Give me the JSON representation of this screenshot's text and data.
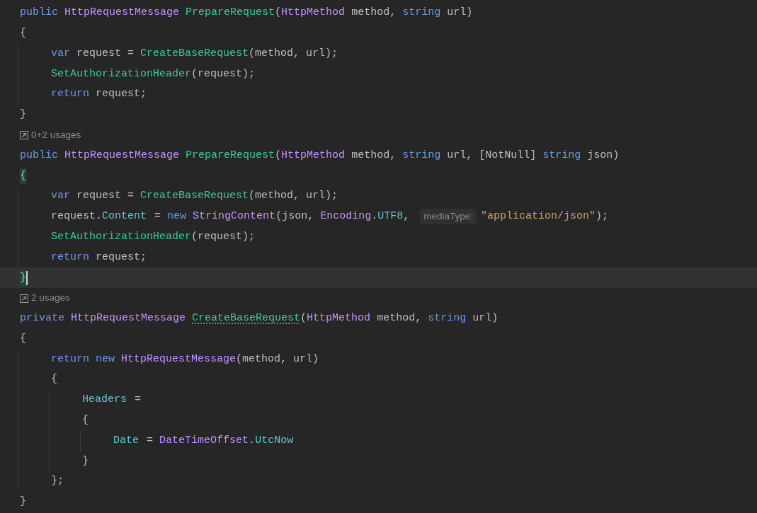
{
  "editor": {
    "lines": [
      {
        "kind": "code",
        "current": false,
        "tokens": [
          {
            "t": "public ",
            "kind": "keyword"
          },
          {
            "t": "HttpRequestMessage ",
            "kind": "type"
          },
          {
            "t": "PrepareRequest",
            "kind": "method"
          },
          {
            "t": "(",
            "kind": "plain"
          },
          {
            "t": "HttpMethod ",
            "kind": "type"
          },
          {
            "t": "method, ",
            "kind": "plain"
          },
          {
            "t": "string ",
            "kind": "keyword"
          },
          {
            "t": "url)",
            "kind": "plain"
          }
        ]
      },
      {
        "kind": "code",
        "current": false,
        "tokens": [
          {
            "t": "{",
            "kind": "plain"
          }
        ]
      },
      {
        "kind": "code",
        "current": false,
        "tokens": [
          {
            "t": "    var ",
            "kind": "keyword"
          },
          {
            "t": "request = ",
            "kind": "plain"
          },
          {
            "t": "CreateBaseRequest",
            "kind": "method"
          },
          {
            "t": "(method, url);",
            "kind": "plain"
          }
        ]
      },
      {
        "kind": "code",
        "current": false,
        "tokens": [
          {
            "t": "    SetAuthorizationHeader",
            "kind": "method"
          },
          {
            "t": "(request);",
            "kind": "plain"
          }
        ]
      },
      {
        "kind": "code",
        "current": false,
        "tokens": [
          {
            "t": "    return ",
            "kind": "keyword"
          },
          {
            "t": "request;",
            "kind": "plain"
          }
        ]
      },
      {
        "kind": "code",
        "current": false,
        "tokens": [
          {
            "t": "}",
            "kind": "plain"
          }
        ]
      },
      {
        "kind": "usages",
        "text": "0+2 usages"
      },
      {
        "kind": "code",
        "current": false,
        "tokens": [
          {
            "t": "public ",
            "kind": "keyword"
          },
          {
            "t": "HttpRequestMessage ",
            "kind": "type"
          },
          {
            "t": "PrepareRequest",
            "kind": "method"
          },
          {
            "t": "(",
            "kind": "plain"
          },
          {
            "t": "HttpMethod ",
            "kind": "type"
          },
          {
            "t": "method, ",
            "kind": "plain"
          },
          {
            "t": "string ",
            "kind": "keyword"
          },
          {
            "t": "url, [NotNull] ",
            "kind": "plain"
          },
          {
            "t": "string ",
            "kind": "keyword"
          },
          {
            "t": "json)",
            "kind": "plain"
          }
        ]
      },
      {
        "kind": "code",
        "current": false,
        "tokens": [
          {
            "t": "{",
            "kind": "plain",
            "matched": true
          }
        ]
      },
      {
        "kind": "code",
        "current": false,
        "tokens": [
          {
            "t": "    var ",
            "kind": "keyword"
          },
          {
            "t": "request = ",
            "kind": "plain"
          },
          {
            "t": "CreateBaseRequest",
            "kind": "method"
          },
          {
            "t": "(method, url);",
            "kind": "plain"
          }
        ]
      },
      {
        "kind": "code",
        "current": false,
        "tokens": [
          {
            "t": "    request.",
            "kind": "plain"
          },
          {
            "t": "Content",
            "kind": "field"
          },
          {
            "t": " = ",
            "kind": "plain"
          },
          {
            "t": "new ",
            "kind": "keyword"
          },
          {
            "t": "StringContent",
            "kind": "type"
          },
          {
            "t": "(json, ",
            "kind": "plain"
          },
          {
            "t": "Encoding",
            "kind": "type"
          },
          {
            "t": ".",
            "kind": "plain"
          },
          {
            "t": "UTF8",
            "kind": "field"
          },
          {
            "t": ", ",
            "kind": "plain"
          },
          {
            "t": "mediaType:",
            "kind": "hint"
          },
          {
            "t": "\"application/json\"",
            "kind": "string"
          },
          {
            "t": ");",
            "kind": "plain"
          }
        ]
      },
      {
        "kind": "code",
        "current": false,
        "tokens": [
          {
            "t": "    SetAuthorizationHeader",
            "kind": "method"
          },
          {
            "t": "(request);",
            "kind": "plain"
          }
        ]
      },
      {
        "kind": "code",
        "current": false,
        "tokens": [
          {
            "t": "    return ",
            "kind": "keyword"
          },
          {
            "t": "request;",
            "kind": "plain"
          }
        ]
      },
      {
        "kind": "code",
        "current": true,
        "tokens": [
          {
            "t": "}",
            "kind": "plain",
            "matched": true
          }
        ]
      },
      {
        "kind": "usages",
        "text": "2 usages"
      },
      {
        "kind": "code",
        "current": false,
        "tokens": [
          {
            "t": "private ",
            "kind": "keyword"
          },
          {
            "t": "HttpRequestMessage ",
            "kind": "type"
          },
          {
            "t": "CreateBaseRequest",
            "kind": "method",
            "underline": true
          },
          {
            "t": "(",
            "kind": "plain"
          },
          {
            "t": "HttpMethod ",
            "kind": "type"
          },
          {
            "t": "method, ",
            "kind": "plain"
          },
          {
            "t": "string ",
            "kind": "keyword"
          },
          {
            "t": "url)",
            "kind": "plain"
          }
        ]
      },
      {
        "kind": "code",
        "current": false,
        "tokens": [
          {
            "t": "{",
            "kind": "plain"
          }
        ]
      },
      {
        "kind": "code",
        "current": false,
        "tokens": [
          {
            "t": "    return ",
            "kind": "keyword"
          },
          {
            "t": "new ",
            "kind": "keyword"
          },
          {
            "t": "HttpRequestMessage",
            "kind": "type"
          },
          {
            "t": "(method, url)",
            "kind": "plain"
          }
        ]
      },
      {
        "kind": "code",
        "current": false,
        "tokens": [
          {
            "t": "    {",
            "kind": "plain"
          }
        ]
      },
      {
        "kind": "code",
        "current": false,
        "tokens": [
          {
            "t": "        Headers",
            "kind": "field"
          },
          {
            "t": " =",
            "kind": "plain"
          }
        ]
      },
      {
        "kind": "code",
        "current": false,
        "tokens": [
          {
            "t": "        {",
            "kind": "plain"
          }
        ]
      },
      {
        "kind": "code",
        "current": false,
        "tokens": [
          {
            "t": "            Date",
            "kind": "field"
          },
          {
            "t": " = ",
            "kind": "plain"
          },
          {
            "t": "DateTimeOffset",
            "kind": "type"
          },
          {
            "t": ".",
            "kind": "plain"
          },
          {
            "t": "UtcNow",
            "kind": "field"
          }
        ]
      },
      {
        "kind": "code",
        "current": false,
        "tokens": [
          {
            "t": "        }",
            "kind": "plain"
          }
        ]
      },
      {
        "kind": "code",
        "current": false,
        "tokens": [
          {
            "t": "    };",
            "kind": "plain"
          }
        ]
      },
      {
        "kind": "code",
        "current": false,
        "tokens": [
          {
            "t": "}",
            "kind": "plain"
          }
        ]
      }
    ]
  }
}
